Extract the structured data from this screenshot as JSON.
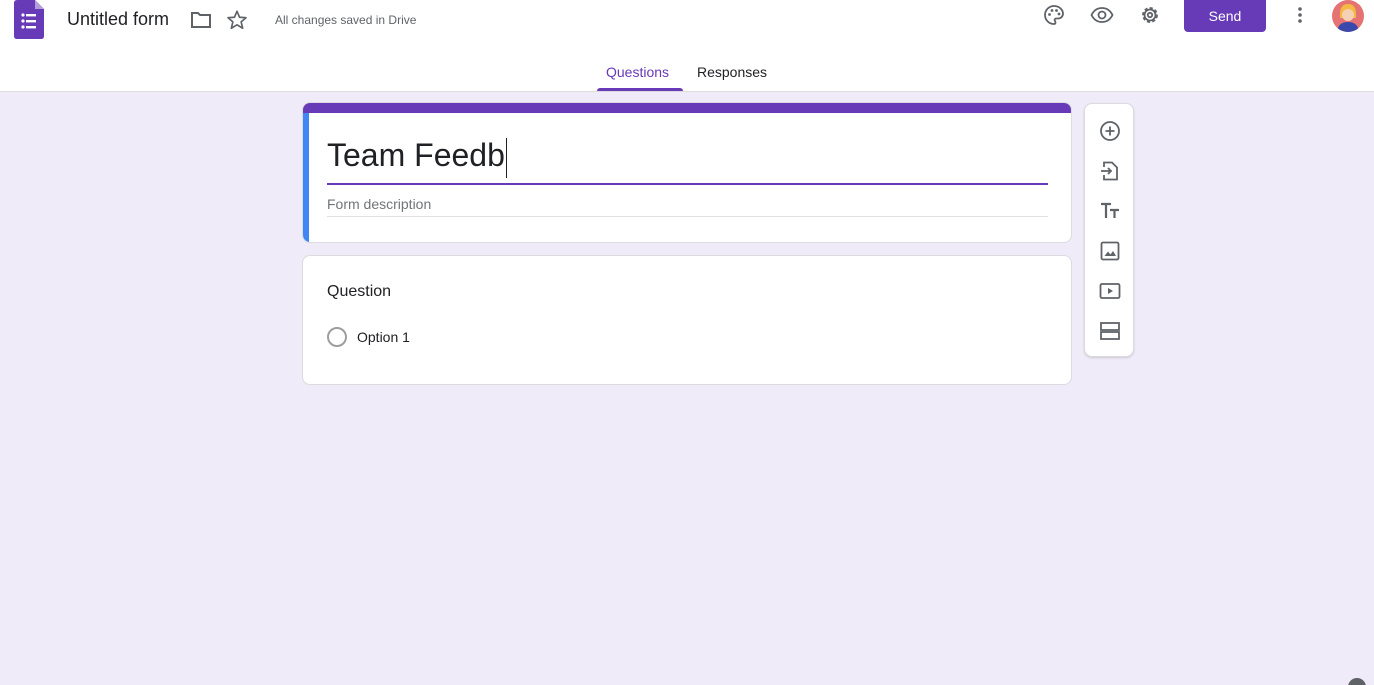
{
  "app": {
    "doc_title": "Untitled form",
    "save_status": "All changes saved in Drive",
    "send_label": "Send"
  },
  "tabs": [
    {
      "label": "Questions",
      "active": true
    },
    {
      "label": "Responses",
      "active": false
    }
  ],
  "form": {
    "title_value": "Team Feedb",
    "description_placeholder": "Form description"
  },
  "question": {
    "title": "Question",
    "options": [
      {
        "label": "Option 1"
      }
    ]
  },
  "toolbar": {
    "tools": [
      "add-question-icon",
      "import-questions-icon",
      "add-title-icon",
      "add-image-icon",
      "add-video-icon",
      "add-section-icon"
    ]
  },
  "colors": {
    "accent": "#673ab7",
    "left_accent": "#4285f4",
    "background": "#f0ebf8"
  }
}
